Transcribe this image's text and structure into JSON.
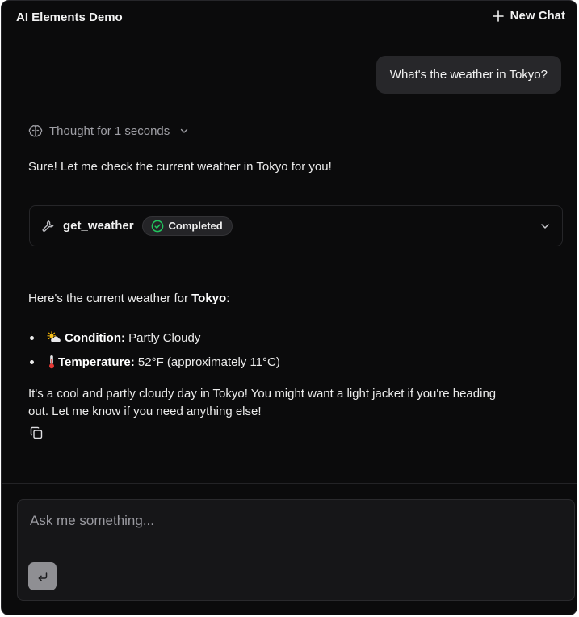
{
  "header": {
    "title": "AI Elements Demo",
    "new_chat_label": "New Chat"
  },
  "conversation": {
    "user_message": "What's the weather in Tokyo?",
    "thought_label": "Thought for 1 seconds",
    "intro_text": "Sure! Let me check the current weather in Tokyo for you!",
    "tool": {
      "name": "get_weather",
      "status": "Completed"
    },
    "result_prefix": "Here's the current weather for ",
    "result_city": "Tokyo",
    "result_suffix": ":",
    "bullets": [
      {
        "icon": "sun-cloud-icon",
        "label": "Condition:",
        "value": " Partly Cloudy"
      },
      {
        "icon": "thermometer-icon",
        "label": "Temperature:",
        "value": " 52°F (approximately 11°C)"
      }
    ],
    "closing_line_1": "It's a cool and partly cloudy day in Tokyo! You might want a light jacket if you're heading",
    "closing_line_2": "out. Let me know if you need anything else!"
  },
  "composer": {
    "placeholder": "Ask me something..."
  },
  "colors": {
    "background": "#0b0b0c",
    "bubble": "#27272a",
    "success": "#22c55e",
    "send_button": "#8f8f93"
  }
}
